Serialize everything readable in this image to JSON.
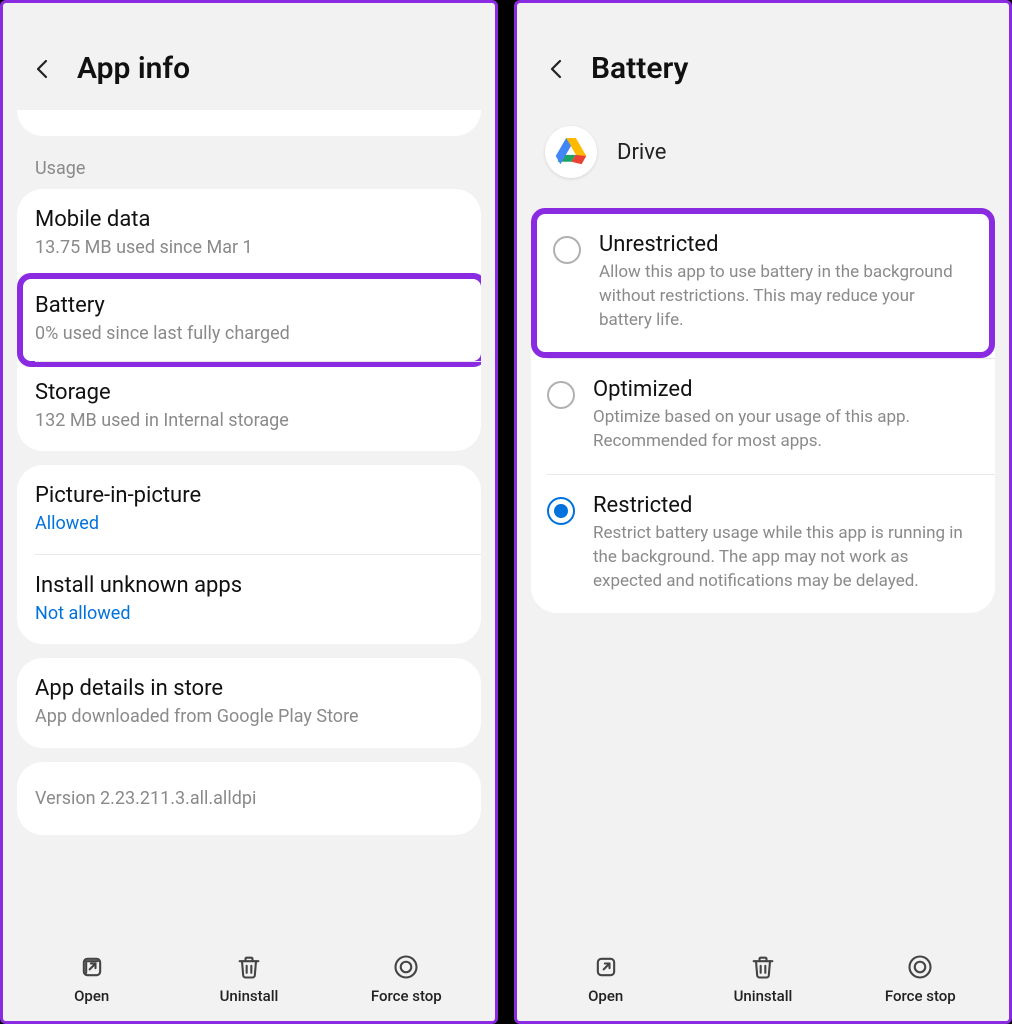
{
  "left": {
    "header_title": "App info",
    "section_label": "Usage",
    "rows": {
      "mobile_data": {
        "title": "Mobile data",
        "sub": "13.75 MB used since Mar 1"
      },
      "battery": {
        "title": "Battery",
        "sub": "0% used since last fully charged"
      },
      "storage": {
        "title": "Storage",
        "sub": "132 MB used in Internal storage"
      },
      "pip": {
        "title": "Picture-in-picture",
        "sub": "Allowed"
      },
      "install_unknown": {
        "title": "Install unknown apps",
        "sub": "Not allowed"
      },
      "app_details": {
        "title": "App details in store",
        "sub": "App downloaded from Google Play Store"
      }
    },
    "version": "Version 2.23.211.3.all.alldpi",
    "bottom": {
      "open": "Open",
      "uninstall": "Uninstall",
      "force_stop": "Force stop"
    }
  },
  "right": {
    "header_title": "Battery",
    "app_name": "Drive",
    "options": {
      "unrestricted": {
        "title": "Unrestricted",
        "desc": "Allow this app to use battery in the background without restrictions. This may reduce your battery life."
      },
      "optimized": {
        "title": "Optimized",
        "desc": "Optimize based on your usage of this app. Recommended for most apps."
      },
      "restricted": {
        "title": "Restricted",
        "desc": "Restrict battery usage while this app is running in the background. The app may not work as expected and notifications may be delayed."
      }
    },
    "selected": "restricted",
    "bottom": {
      "open": "Open",
      "uninstall": "Uninstall",
      "force_stop": "Force stop"
    }
  }
}
